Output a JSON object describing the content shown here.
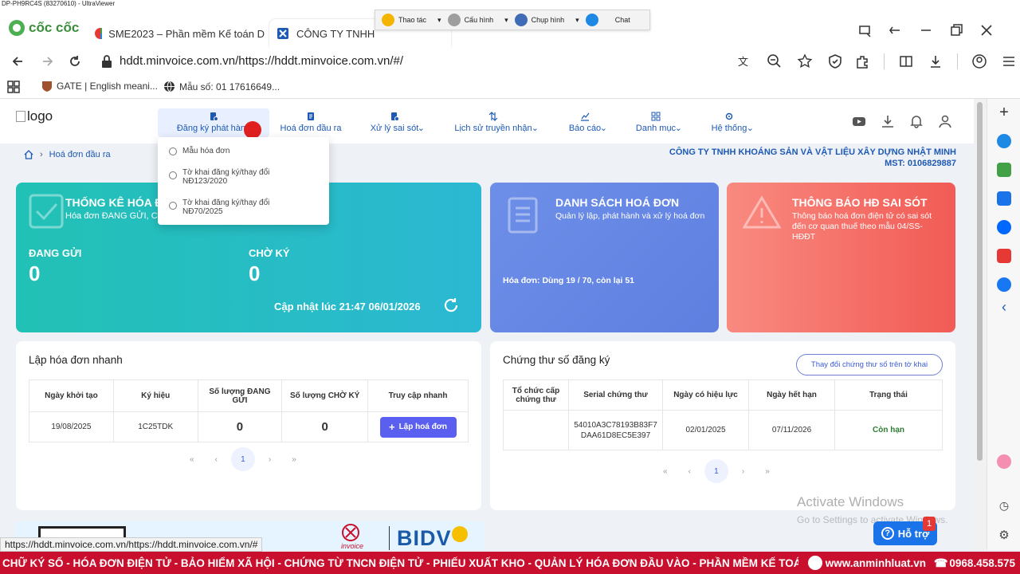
{
  "window_title": "DP-PH9RC4S (83270610) - UltraViewer",
  "browser": {
    "brand": "cốc cốc",
    "tabs": [
      {
        "label": "SME2023 – Phần mềm Kế toán D"
      },
      {
        "label": "CÔNG TY TNHH "
      }
    ],
    "address": "hddt.minvoice.com.vn/https://hddt.minvoice.com.vn/#/",
    "bookmarks": [
      {
        "label": "GATE | English meani..."
      },
      {
        "label": "Mẫu số: 01 17616649..."
      }
    ]
  },
  "ultraviewer_toolbar": {
    "items": [
      {
        "label": "Thao tác"
      },
      {
        "label": "Cấu hình"
      },
      {
        "label": "Chụp hình"
      },
      {
        "label": "Chat"
      }
    ]
  },
  "app": {
    "logo_alt": "logo",
    "menu": [
      {
        "label": "Đăng ký phát hành"
      },
      {
        "label": "Hoá đơn đầu ra"
      },
      {
        "label": "Xử lý sai sót"
      },
      {
        "label": "Lịch sử truyền nhận"
      },
      {
        "label": "Báo cáo"
      },
      {
        "label": "Danh mục"
      },
      {
        "label": "Hệ thống"
      }
    ],
    "dropdown": [
      {
        "label": "Mẫu hóa đơn"
      },
      {
        "label": "Tờ khai đăng ký/thay đổi NĐ123/2020"
      },
      {
        "label": "Tờ khai đăng ký/thay đổi NĐ70/2025"
      }
    ],
    "breadcrumb": "Hoá đơn đầu ra",
    "company": {
      "name": "CÔNG TY TNHH KHOÁNG SẢN VÀ VẬT LIỆU XÂY DỰNG NHẬT MINH",
      "mst": "MST: 0106829887"
    },
    "stats_card": {
      "title": "THỐNG KÊ HÓA Đ",
      "subtitle": "Hóa đơn ĐANG GỬI, C",
      "sending_label": "ĐANG GỬI",
      "sending_value": "0",
      "pending_label": "CHỜ KÝ",
      "pending_value": "0",
      "updated": "Cập nhật lúc 21:47 06/01/2026"
    },
    "list_card": {
      "title": "DANH SÁCH HOÁ ĐƠN",
      "subtitle": "Quản lý lập, phát hành và xử lý hoá đơn",
      "usage": "Hóa đơn: Dùng 19 / 70, còn lại 51"
    },
    "error_card": {
      "title": "THÔNG BÁO HĐ SAI SÓT",
      "subtitle": "Thông báo hoá đơn điện tử có sai sót đến cơ quan thuế theo mẫu 04/SS-HĐĐT"
    },
    "quick": {
      "title": "Lập hóa đơn nhanh",
      "headers": [
        "Ngày khởi tạo",
        "Ký hiệu",
        "Số lượng ĐANG GỬI",
        "Số lượng CHỜ KÝ",
        "Truy cập nhanh"
      ],
      "row": {
        "date": "19/08/2025",
        "symbol": "1C25TDK",
        "sending": "0",
        "pending": "0"
      },
      "button": "Lập hoá đơn",
      "page": "1"
    },
    "cert": {
      "title": "Chứng thư số đăng ký",
      "change_button": "Thay đổi chứng thư số trên tờ khai",
      "headers": [
        "Tổ chức cấp chứng thư",
        "Serial chứng thư",
        "Ngày có hiệu lực",
        "Ngày hết hạn",
        "Trạng thái"
      ],
      "row": {
        "issuer": "",
        "serial": "54010A3C78193B83F7DAA61D8EC5E397",
        "valid_from": "02/01/2025",
        "valid_to": "07/11/2026",
        "status": "Còn hạn"
      },
      "page": "1"
    },
    "banner": {
      "bank": "BIDV",
      "partner": "invoice"
    }
  },
  "status_url": "https://hddt.minvoice.com.vn/https://hddt.minvoice.com.vn/#",
  "help": {
    "label": "Hỗ trợ",
    "badge": "1"
  },
  "windows_watermark": {
    "line1": "Activate Windows",
    "line2": "Go to Settings to activate Windows."
  },
  "ticker": {
    "text": "CHỮ KÝ SỐ - HÓA ĐƠN ĐIỆN TỬ - BẢO HIỂM XÃ HỘI - CHỨNG TỪ TNCN ĐIỆN TỬ - PHIẾU XUẤT KHO - QUẢN LÝ HÓA ĐƠN ĐẦU VÀO - PHẦN MỀM KẾ TOÁN - PHẦN MỀM BÁN HÀNG |",
    "website": "www.anminhluat.vn",
    "phone": "0968.458.575"
  },
  "colors": {
    "accent": "#1e5ab4",
    "teal": "#22c1b5",
    "blue_card": "#6d8fe8",
    "red_card": "#f2706a",
    "primary_btn": "#5b5ff0",
    "ticker": "#c8102e"
  }
}
